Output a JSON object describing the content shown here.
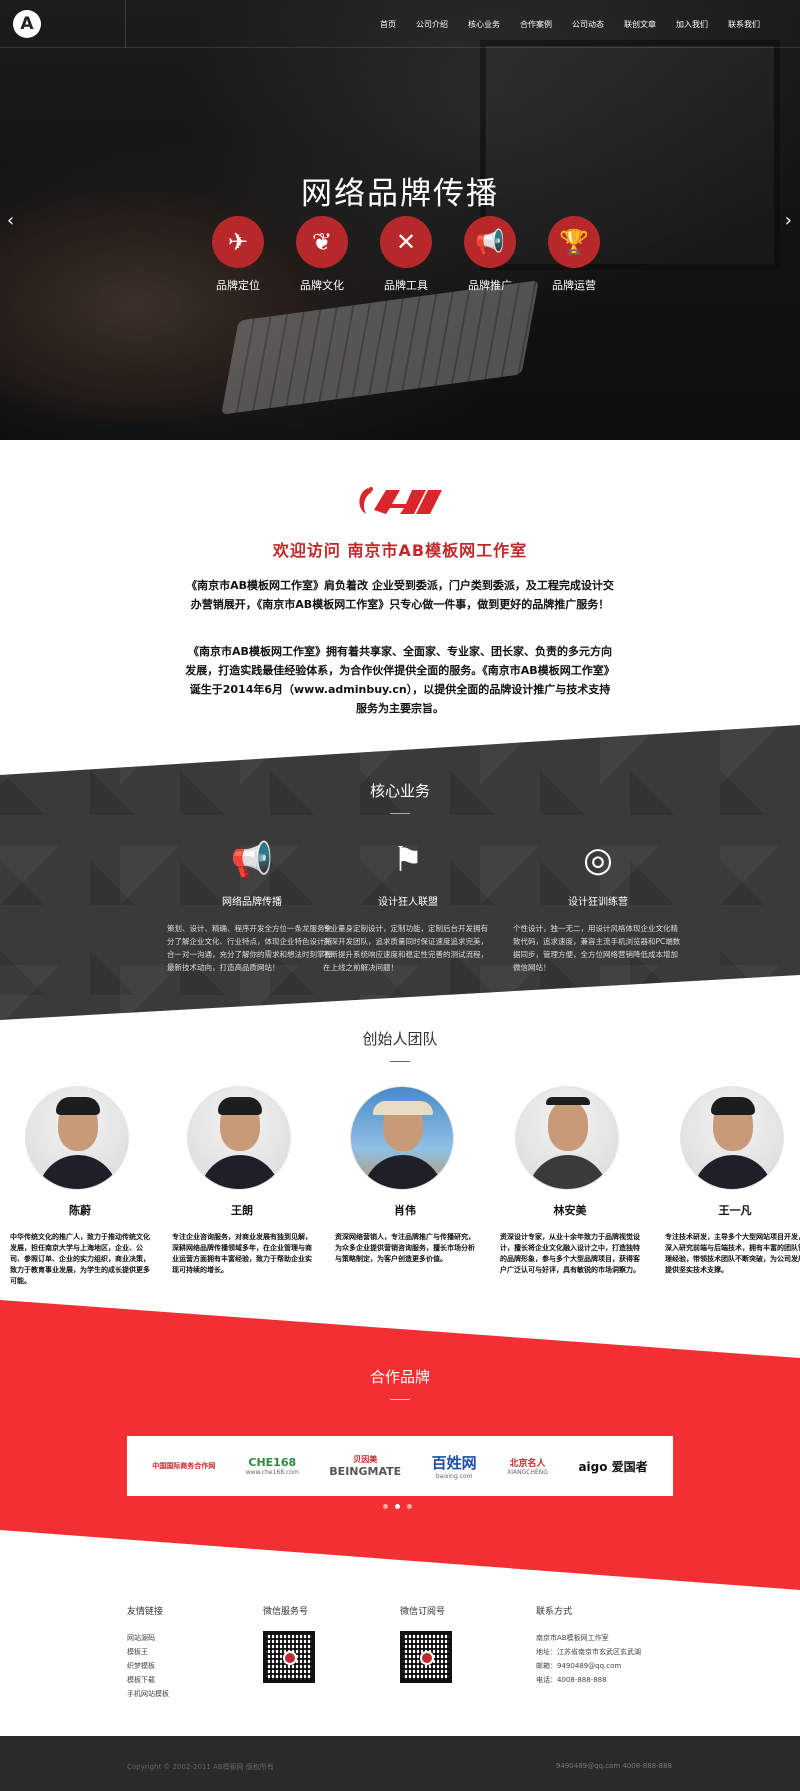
{
  "nav": {
    "logo_letter": "A",
    "items": [
      "首页",
      "公司介绍",
      "核心业务",
      "合作案例",
      "公司动态",
      "联创文章",
      "加入我们",
      "联系我们"
    ]
  },
  "hero": {
    "title": "网络品牌传播",
    "features": [
      {
        "label": "品牌定位",
        "icon": "paper-plane-icon",
        "glyph": "✈"
      },
      {
        "label": "品牌文化",
        "icon": "leaf-icon",
        "glyph": "❦"
      },
      {
        "label": "品牌工具",
        "icon": "tools-icon",
        "glyph": "✕"
      },
      {
        "label": "品牌推广",
        "icon": "megaphone-icon",
        "glyph": "📢"
      },
      {
        "label": "品牌运营",
        "icon": "trophy-icon",
        "glyph": "🏆"
      }
    ]
  },
  "welcome": {
    "title": "欢迎访问 南京市AB模板网工作室",
    "para1": "《南京市AB模板网工作室》肩负着改 企业受到委派，门户类到委派，及工程完成设计交办营销展开，《南京市AB模板网工作室》只专心做一件事，做到更好的品牌推广服务！",
    "para2": "《南京市AB模板网工作室》拥有着共享家、全面家、专业家、团长家、负责的多元方向发展，打造实践最佳经验体系，为合作伙伴提供全面的服务。《南京市AB模板网工作室》诞生于2014年6月（www.adminbuy.cn），以提供全面的品牌设计推广与技术支持服务为主要宗旨。"
  },
  "core": {
    "title": "核心业务",
    "services": [
      {
        "title": "网络品牌传播",
        "icon": "megaphone-icon",
        "glyph": "📢",
        "desc": "策划、设计、精确、程序开发全方位一条龙服务充分了解企业文化、行业特点，体现企业特色设计符合一对一沟通，充分了解你的需求和想法时刻掌握最新技术动向，打造高品质网站！"
      },
      {
        "title": "设计狂人联盟",
        "icon": "flag-icon",
        "glyph": "⚑",
        "desc": "专业量身定制设计，定制功能，定制后台开发拥有资深开发团队，追求质量同时保证速度追求完美，不断提升系统响应速度和稳定性完善的测试流程，在上线之前解决问题！"
      },
      {
        "title": "设计狂训练营",
        "icon": "target-icon",
        "glyph": "◎",
        "desc": "个性设计，独一无二，用设计风格体现企业文化精致代码，追求速度，兼容主流手机浏览器和PC端数据同步，管理方便，全方位网络营销降低成本增加微信网站！"
      }
    ]
  },
  "founders": {
    "title": "创始人团队",
    "members": [
      {
        "name": "陈蔚",
        "desc": "中华传统文化的推广人，致力于推动传统文化发展，担任南京大学与上海地区，企业、公司、参照订单、企业的实力组织，商业决策，致力于教育事业发展，为学生的成长提供更多可能。"
      },
      {
        "name": "王朗",
        "desc": "专注企业咨询服务，对商业发展有独到见解，深耕网络品牌传播领域多年，在企业管理与商业运营方面拥有丰富经验，致力于帮助企业实现可持续的增长。"
      },
      {
        "name": "肖伟",
        "desc": "资深网络营销人，专注品牌推广与传播研究，为众多企业提供营销咨询服务，擅长市场分析与策略制定，为客户创造更多价值。"
      },
      {
        "name": "林安美",
        "desc": "资深设计专家，从业十余年致力于品牌视觉设计，擅长将企业文化融入设计之中，打造独特的品牌形象，参与多个大型品牌项目，获得客户广泛认可与好评，具有敏锐的市场洞察力。"
      },
      {
        "name": "王一凡",
        "desc": "专注技术研发，主导多个大型网站项目开发，深入研究前端与后端技术，拥有丰富的团队管理经验，带领技术团队不断突破，为公司发展提供坚实技术支撑。"
      }
    ]
  },
  "partners": {
    "title": "合作品牌",
    "logos": [
      {
        "name": "中国国际商务合作网",
        "sub": ""
      },
      {
        "name": "CHE168",
        "sub": "www.che168.com"
      },
      {
        "name": "BEINGMATE",
        "sub": "贝因美"
      },
      {
        "name": "百姓网",
        "sub": "baixing.com"
      },
      {
        "name": "北京名人",
        "sub": "XIANGCHENG"
      },
      {
        "name": "aigo 爱国者",
        "sub": ""
      }
    ],
    "active_dot": 1
  },
  "footer": {
    "links_title": "友情链接",
    "links": [
      "网站源码",
      "模板王",
      "织梦模板",
      "模板下载",
      "手机网站模板"
    ],
    "wechat_service": "微信服务号",
    "wechat_sub": "微信订阅号",
    "contact_title": "联系方式",
    "contact": [
      "南京市AB模板网工作室",
      "地址：江苏省南京市玄武区玄武湖",
      "邮箱：9490489@qq.com",
      "电话：4008-888-888"
    ],
    "copyright": "Copyright © 2002-2011 AB模板网 版权所有",
    "mini_contact": "9490489@qq.com    4008-888-888"
  }
}
